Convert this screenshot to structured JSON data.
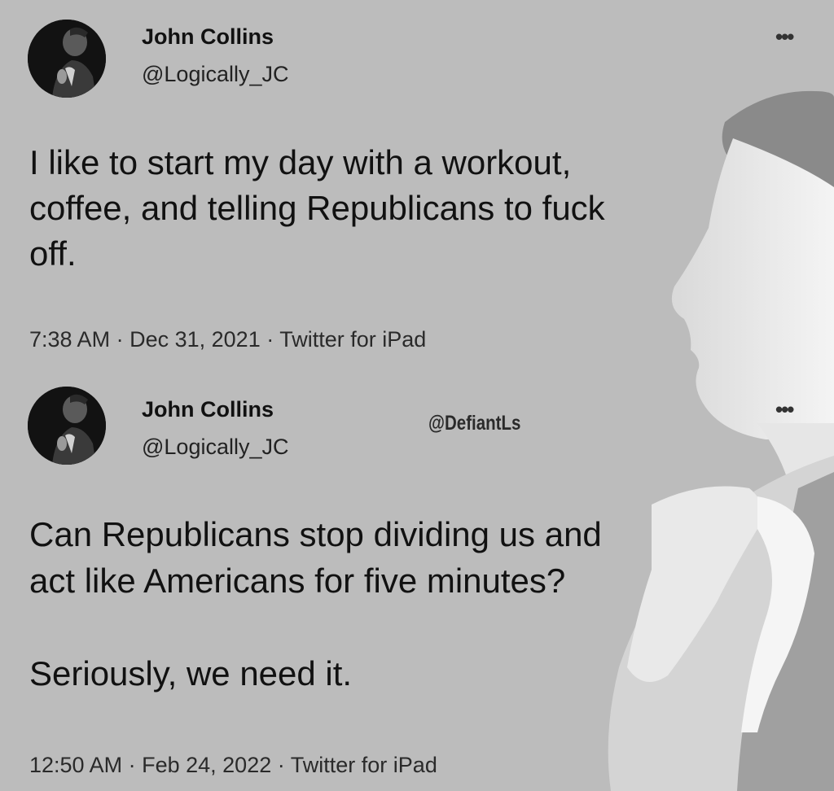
{
  "tweets": [
    {
      "author_name": "John Collins",
      "author_handle": "@Logically_JC",
      "more_icon": "more-horizontal-icon",
      "text": "I like to start my day with a workout,\ncoffee, and telling Republicans to fuck\noff.",
      "time": "7:38 AM",
      "date": "Dec 31, 2021",
      "source": "Twitter for iPad"
    },
    {
      "author_name": "John Collins",
      "author_handle": "@Logically_JC",
      "more_icon": "more-horizontal-icon",
      "text": "Can Republicans stop dividing us and\nact like Americans for five minutes?\n\nSeriously, we need it.",
      "time": "12:50 AM",
      "date": "Feb 24, 2022",
      "source": "Twitter for iPad"
    }
  ],
  "watermark": "@DefiantLs",
  "separator": "·",
  "colors": {
    "background": "#bcbcbc",
    "text": "#111111",
    "silhouette": "#f2f2f2"
  }
}
